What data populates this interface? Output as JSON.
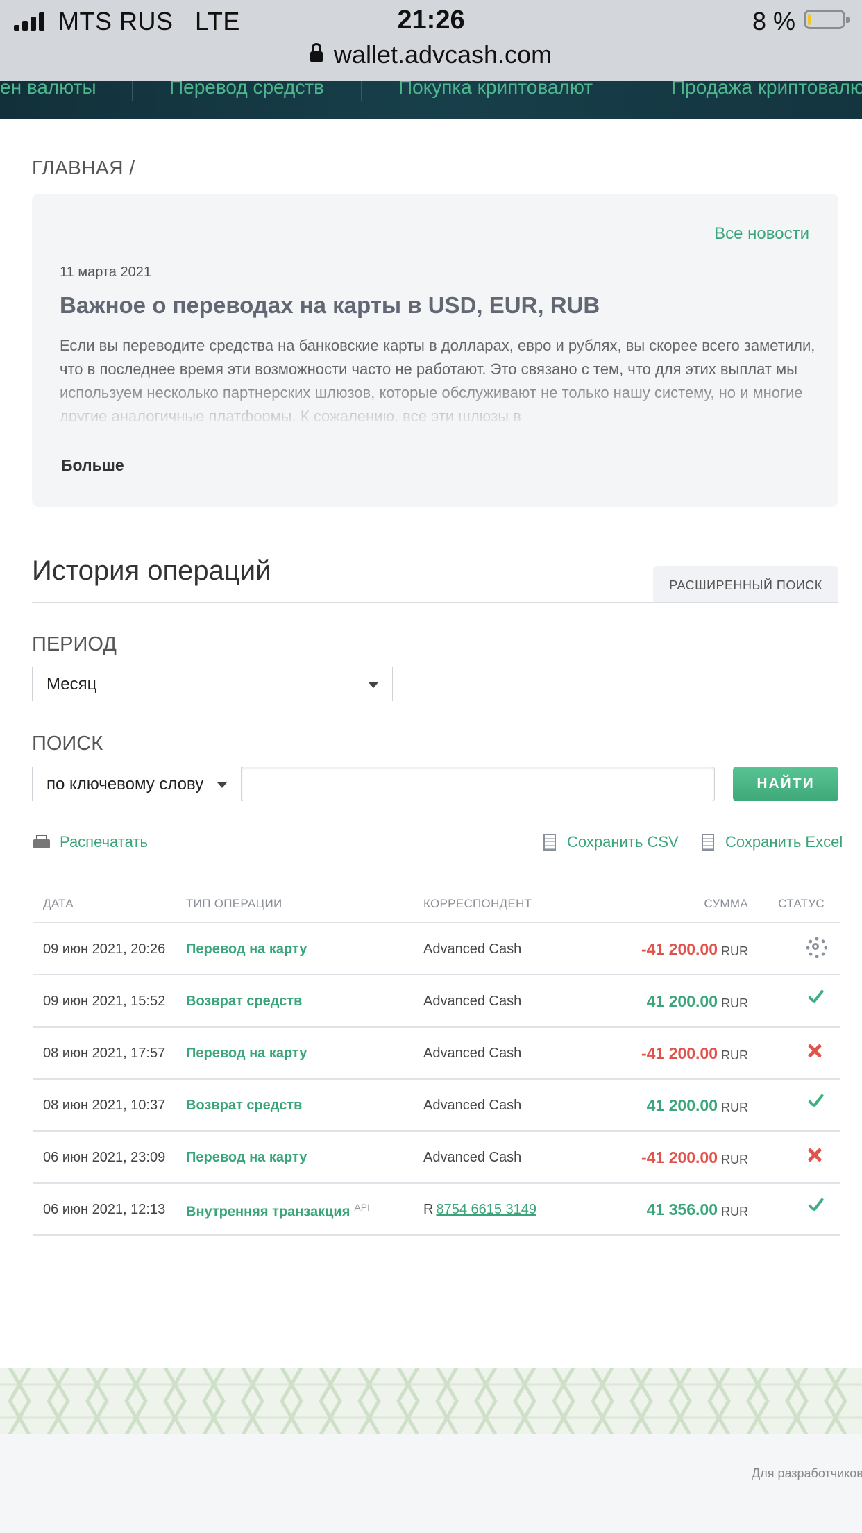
{
  "status_bar": {
    "carrier": "MTS RUS   LTE",
    "time": "21:26",
    "battery_percent_label": "8 %",
    "battery_level": 0.08,
    "url": "wallet.advcash.com"
  },
  "top_nav": {
    "items": [
      "ен валюты",
      "Перевод средств",
      "Покупка криптовалют",
      "Продажа криптовалю"
    ]
  },
  "breadcrumb": "ГЛАВНАЯ /",
  "news": {
    "all_news_label": "Все новости",
    "date": "11 марта 2021",
    "title": "Важное о переводах на карты в USD, EUR, RUB",
    "body": "Если вы переводите средства на банковские карты в долларах, евро и рублях, вы скорее всего заметили, что в последнее время эти возможности часто не работают. Это связано с тем, что для этих выплат мы используем несколько партнерских шлюзов, которые обслуживают не только нашу систему, но и многие другие аналогичные платформы. К сожалению, все эти шлюзы в",
    "more_label": "Больше"
  },
  "history": {
    "title": "История операций",
    "advanced_search_label": "РАСШИРЕННЫЙ ПОИСК",
    "period_label": "ПЕРИОД",
    "period_value": "Месяц",
    "search_label": "ПОИСК",
    "search_type_value": "по ключевому слову",
    "search_input_value": "",
    "find_label": "НАЙТИ",
    "print_label": "Распечатать",
    "save_csv_label": "Сохранить CSV",
    "save_excel_label": "Сохранить Excel"
  },
  "table": {
    "headers": {
      "date": "ДАТА",
      "type": "ТИП ОПЕРАЦИИ",
      "correspondent": "КОРРЕСПОНДЕНТ",
      "amount": "СУММА",
      "status": "СТАТУС"
    },
    "rows": [
      {
        "date": "09 июн 2021, 20:26",
        "type": "Перевод на карту",
        "type_badge": "",
        "corr_prefix": "",
        "correspondent": "Advanced Cash",
        "amount": "-41 200.00",
        "currency": "RUR",
        "status": "processing"
      },
      {
        "date": "09 июн 2021, 15:52",
        "type": "Возврат средств",
        "type_badge": "",
        "corr_prefix": "",
        "correspondent": "Advanced Cash",
        "amount": "41 200.00",
        "currency": "RUR",
        "status": "completed"
      },
      {
        "date": "08 июн 2021, 17:57",
        "type": "Перевод на карту",
        "type_badge": "",
        "corr_prefix": "",
        "correspondent": "Advanced Cash",
        "amount": "-41 200.00",
        "currency": "RUR",
        "status": "failed"
      },
      {
        "date": "08 июн 2021, 10:37",
        "type": "Возврат средств",
        "type_badge": "",
        "corr_prefix": "",
        "correspondent": "Advanced Cash",
        "amount": "41 200.00",
        "currency": "RUR",
        "status": "completed"
      },
      {
        "date": "06 июн 2021, 23:09",
        "type": "Перевод на карту",
        "type_badge": "",
        "corr_prefix": "",
        "correspondent": "Advanced Cash",
        "amount": "-41 200.00",
        "currency": "RUR",
        "status": "failed"
      },
      {
        "date": "06 июн 2021, 12:13",
        "type": "Внутренняя транзакция",
        "type_badge": "API",
        "corr_prefix": "R",
        "correspondent": "8754 6615 3149",
        "amount": "41 356.00",
        "currency": "RUR",
        "status": "completed"
      }
    ]
  },
  "footer": {
    "developers_label": "Для разработчиков"
  },
  "colors": {
    "accent_green": "#3aa57a",
    "negative_red": "#e0524a",
    "nav_dark": "#143540"
  }
}
